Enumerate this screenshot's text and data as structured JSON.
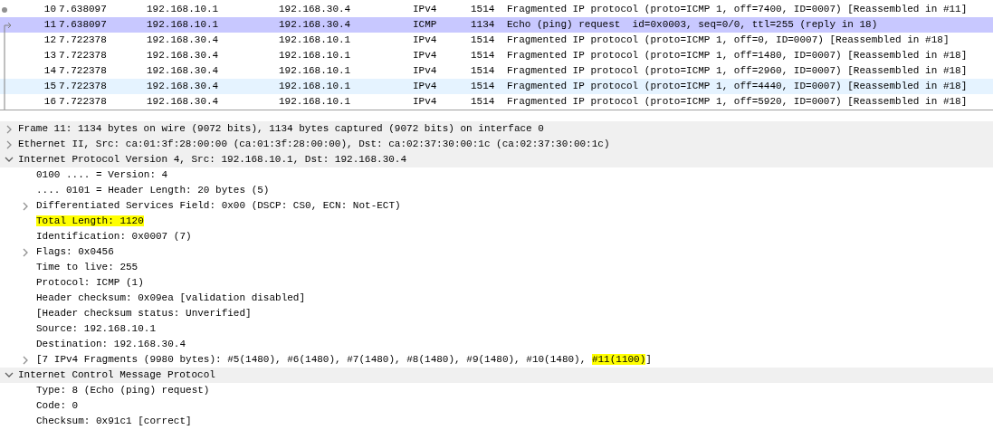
{
  "packet_list": {
    "rows": [
      {
        "no": "10",
        "time": "7.638097",
        "source": "192.168.10.1",
        "destination": "192.168.30.4",
        "protocol": "IPv4",
        "length": "1514",
        "info": "Fragmented IP protocol (proto=ICMP 1, off=7400, ID=0007) [Reassembled in #11]",
        "selected": false,
        "hovered": false,
        "kind": "dot"
      },
      {
        "no": "11",
        "time": "7.638097",
        "source": "192.168.10.1",
        "destination": "192.168.30.4",
        "protocol": "ICMP",
        "length": "1134",
        "info": "Echo (ping) request  id=0x0003, seq=0/0, ttl=255 (reply in 18)",
        "selected": true,
        "hovered": false,
        "kind": "arrow"
      },
      {
        "no": "12",
        "time": "7.722378",
        "source": "192.168.30.4",
        "destination": "192.168.10.1",
        "protocol": "IPv4",
        "length": "1514",
        "info": "Fragmented IP protocol (proto=ICMP 1, off=0, ID=0007) [Reassembled in #18]",
        "selected": false,
        "hovered": false,
        "kind": "line"
      },
      {
        "no": "13",
        "time": "7.722378",
        "source": "192.168.30.4",
        "destination": "192.168.10.1",
        "protocol": "IPv4",
        "length": "1514",
        "info": "Fragmented IP protocol (proto=ICMP 1, off=1480, ID=0007) [Reassembled in #18]",
        "selected": false,
        "hovered": false,
        "kind": "line"
      },
      {
        "no": "14",
        "time": "7.722378",
        "source": "192.168.30.4",
        "destination": "192.168.10.1",
        "protocol": "IPv4",
        "length": "1514",
        "info": "Fragmented IP protocol (proto=ICMP 1, off=2960, ID=0007) [Reassembled in #18]",
        "selected": false,
        "hovered": false,
        "kind": "line"
      },
      {
        "no": "15",
        "time": "7.722378",
        "source": "192.168.30.4",
        "destination": "192.168.10.1",
        "protocol": "IPv4",
        "length": "1514",
        "info": "Fragmented IP protocol (proto=ICMP 1, off=4440, ID=0007) [Reassembled in #18]",
        "selected": false,
        "hovered": true,
        "kind": "line"
      },
      {
        "no": "16",
        "time": "7.722378",
        "source": "192.168.30.4",
        "destination": "192.168.10.1",
        "protocol": "IPv4",
        "length": "1514",
        "info": "Fragmented IP protocol (proto=ICMP 1, off=5920, ID=0007) [Reassembled in #18]",
        "selected": false,
        "hovered": false,
        "kind": "line"
      }
    ]
  },
  "packet_details": [
    {
      "parts": [
        {
          "text": "Frame 11: 1134 bytes on wire (9072 bits), 1134 bytes captured (9072 bits) on interface 0",
          "highlighted": false
        }
      ],
      "expandable": true,
      "expanded": false
    },
    {
      "parts": [
        {
          "text": "Ethernet II, Src: ca:01:3f:28:00:00 (ca:01:3f:28:00:00), Dst: ca:02:37:30:00:1c (ca:02:37:30:00:1c)",
          "highlighted": false
        }
      ],
      "expandable": true,
      "expanded": false
    },
    {
      "parts": [
        {
          "text": "Internet Protocol Version 4, Src: 192.168.10.1, Dst: 192.168.30.4",
          "highlighted": false
        }
      ],
      "expandable": true,
      "expanded": true,
      "children": [
        {
          "parts": [
            {
              "text": "0100 .... = Version: 4",
              "highlighted": false
            }
          ],
          "expandable": false
        },
        {
          "parts": [
            {
              "text": ".... 0101 = Header Length: 20 bytes (5)",
              "highlighted": false
            }
          ],
          "expandable": false
        },
        {
          "parts": [
            {
              "text": "Differentiated Services Field: 0x00 (DSCP: CS0, ECN: Not-ECT)",
              "highlighted": false
            }
          ],
          "expandable": true,
          "expanded": false
        },
        {
          "parts": [
            {
              "text": "Total Length: 1120",
              "highlighted": true
            }
          ],
          "expandable": false
        },
        {
          "parts": [
            {
              "text": "Identification: 0x0007 (7)",
              "highlighted": false
            }
          ],
          "expandable": false
        },
        {
          "parts": [
            {
              "text": "Flags: 0x0456",
              "highlighted": false
            }
          ],
          "expandable": true,
          "expanded": false
        },
        {
          "parts": [
            {
              "text": "Time to live: 255",
              "highlighted": false
            }
          ],
          "expandable": false
        },
        {
          "parts": [
            {
              "text": "Protocol: ICMP (1)",
              "highlighted": false
            }
          ],
          "expandable": false
        },
        {
          "parts": [
            {
              "text": "Header checksum: 0x09ea [validation disabled]",
              "highlighted": false
            }
          ],
          "expandable": false
        },
        {
          "parts": [
            {
              "text": "[Header checksum status: Unverified]",
              "highlighted": false
            }
          ],
          "expandable": false
        },
        {
          "parts": [
            {
              "text": "Source: 192.168.10.1",
              "highlighted": false
            }
          ],
          "expandable": false
        },
        {
          "parts": [
            {
              "text": "Destination: 192.168.30.4",
              "highlighted": false
            }
          ],
          "expandable": false
        },
        {
          "parts": [
            {
              "text": "[7 IPv4 Fragments (9980 bytes): #5(1480), #6(1480), #7(1480), #8(1480), #9(1480), #10(1480), ",
              "highlighted": false
            },
            {
              "text": "#11(1100)",
              "highlighted": true
            },
            {
              "text": "]",
              "highlighted": false
            }
          ],
          "expandable": true,
          "expanded": false
        }
      ]
    },
    {
      "parts": [
        {
          "text": "Internet Control Message Protocol",
          "highlighted": false
        }
      ],
      "expandable": true,
      "expanded": true,
      "children": [
        {
          "parts": [
            {
              "text": "Type: 8 (Echo (ping) request)",
              "highlighted": false
            }
          ],
          "expandable": false
        },
        {
          "parts": [
            {
              "text": "Code: 0",
              "highlighted": false
            }
          ],
          "expandable": false
        },
        {
          "parts": [
            {
              "text": "Checksum: 0x91c1 [correct]",
              "highlighted": false
            }
          ],
          "expandable": false
        }
      ]
    }
  ]
}
